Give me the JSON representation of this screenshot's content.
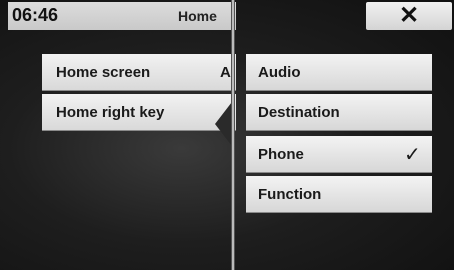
{
  "status_bar": {
    "time": "06:46",
    "title": "Home"
  },
  "left_menu": {
    "items": [
      {
        "label": "Home screen",
        "value": "A"
      },
      {
        "label": "Home right key"
      }
    ]
  },
  "close_button": {
    "icon": "close-icon",
    "glyph": "✕"
  },
  "options_menu": {
    "items": [
      {
        "label": "Audio",
        "selected": false
      },
      {
        "label": "Destination",
        "selected": false
      },
      {
        "label": "Phone",
        "selected": true,
        "check_glyph": "✓"
      },
      {
        "label": "Function",
        "selected": false
      }
    ]
  }
}
